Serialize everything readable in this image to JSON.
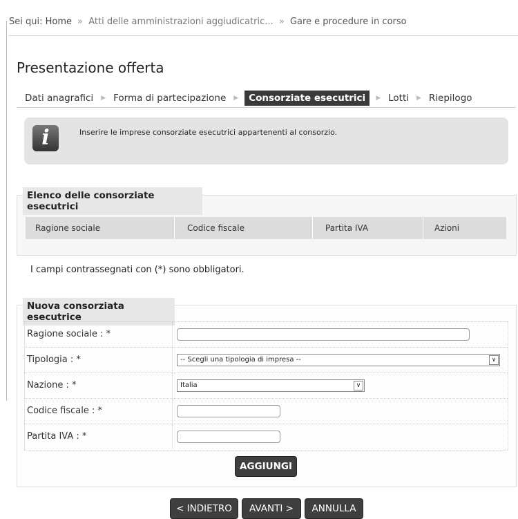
{
  "breadcrumb": {
    "prefix": "Sei qui:",
    "home": "Home",
    "separator": "»",
    "middle": "Atti delle amministrazioni aggiudicatric...",
    "current": "Gare e procedure in corso"
  },
  "page": {
    "title": "Presentazione offerta"
  },
  "steps": [
    {
      "label": "Dati anagrafici",
      "active": false
    },
    {
      "label": "Forma di partecipazione",
      "active": false
    },
    {
      "label": "Consorziate esecutrici",
      "active": true
    },
    {
      "label": "Lotti",
      "active": false
    },
    {
      "label": "Riepilogo",
      "active": false
    }
  ],
  "info": {
    "icon": "info-icon",
    "icon_glyph": "i",
    "message": "Inserire le imprese consorziate esecutrici appartenenti al consorzio."
  },
  "list_section": {
    "legend": "Elenco delle consorziate esecutrici",
    "columns": [
      "Ragione sociale",
      "Codice fiscale",
      "Partita IVA",
      "Azioni"
    ]
  },
  "required_note": "I campi contrassegnati con (*) sono obbligatori.",
  "form_section": {
    "legend": "Nuova consorziata esecutrice",
    "fields": {
      "ragione_sociale": {
        "label": "Ragione sociale : *",
        "value": ""
      },
      "tipologia": {
        "label": "Tipologia : *",
        "selected": "-- Scegli una tipologia di impresa --"
      },
      "nazione": {
        "label": "Nazione : *",
        "selected": "Italia"
      },
      "codice_fiscale": {
        "label": "Codice fiscale : *",
        "value": ""
      },
      "partita_iva": {
        "label": "Partita IVA : *",
        "value": ""
      }
    },
    "add_button": "AGGIUNGI"
  },
  "nav_buttons": {
    "back": "< INDIETRO",
    "next": "AVANTI >",
    "cancel": "ANNULLA"
  }
}
